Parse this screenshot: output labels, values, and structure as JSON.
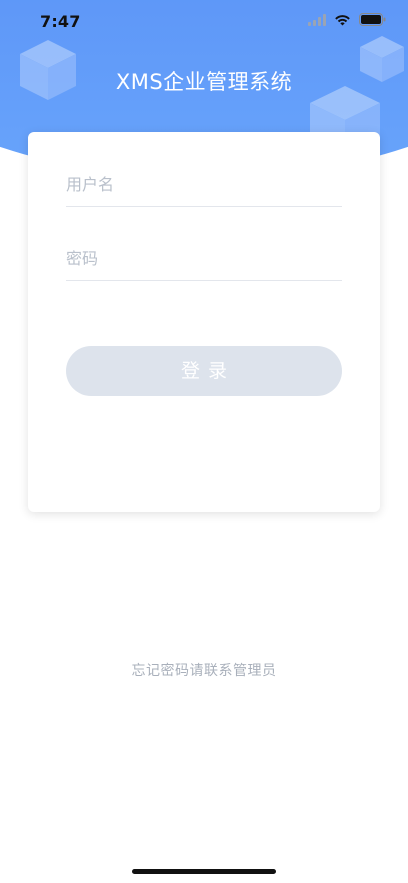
{
  "status_bar": {
    "time": "7:47",
    "icons": [
      "signal-icon",
      "wifi-icon",
      "battery-icon"
    ]
  },
  "header": {
    "title": "XMS企业管理系统",
    "gradient_colors": [
      "#4f86f4",
      "#68a4fb"
    ]
  },
  "login_form": {
    "username_placeholder": "用户名",
    "username_value": "",
    "password_placeholder": "密码",
    "password_value": "",
    "login_label": "登录",
    "login_button_color": "#dde3ec"
  },
  "footer": {
    "note": "忘记密码请联系管理员"
  }
}
